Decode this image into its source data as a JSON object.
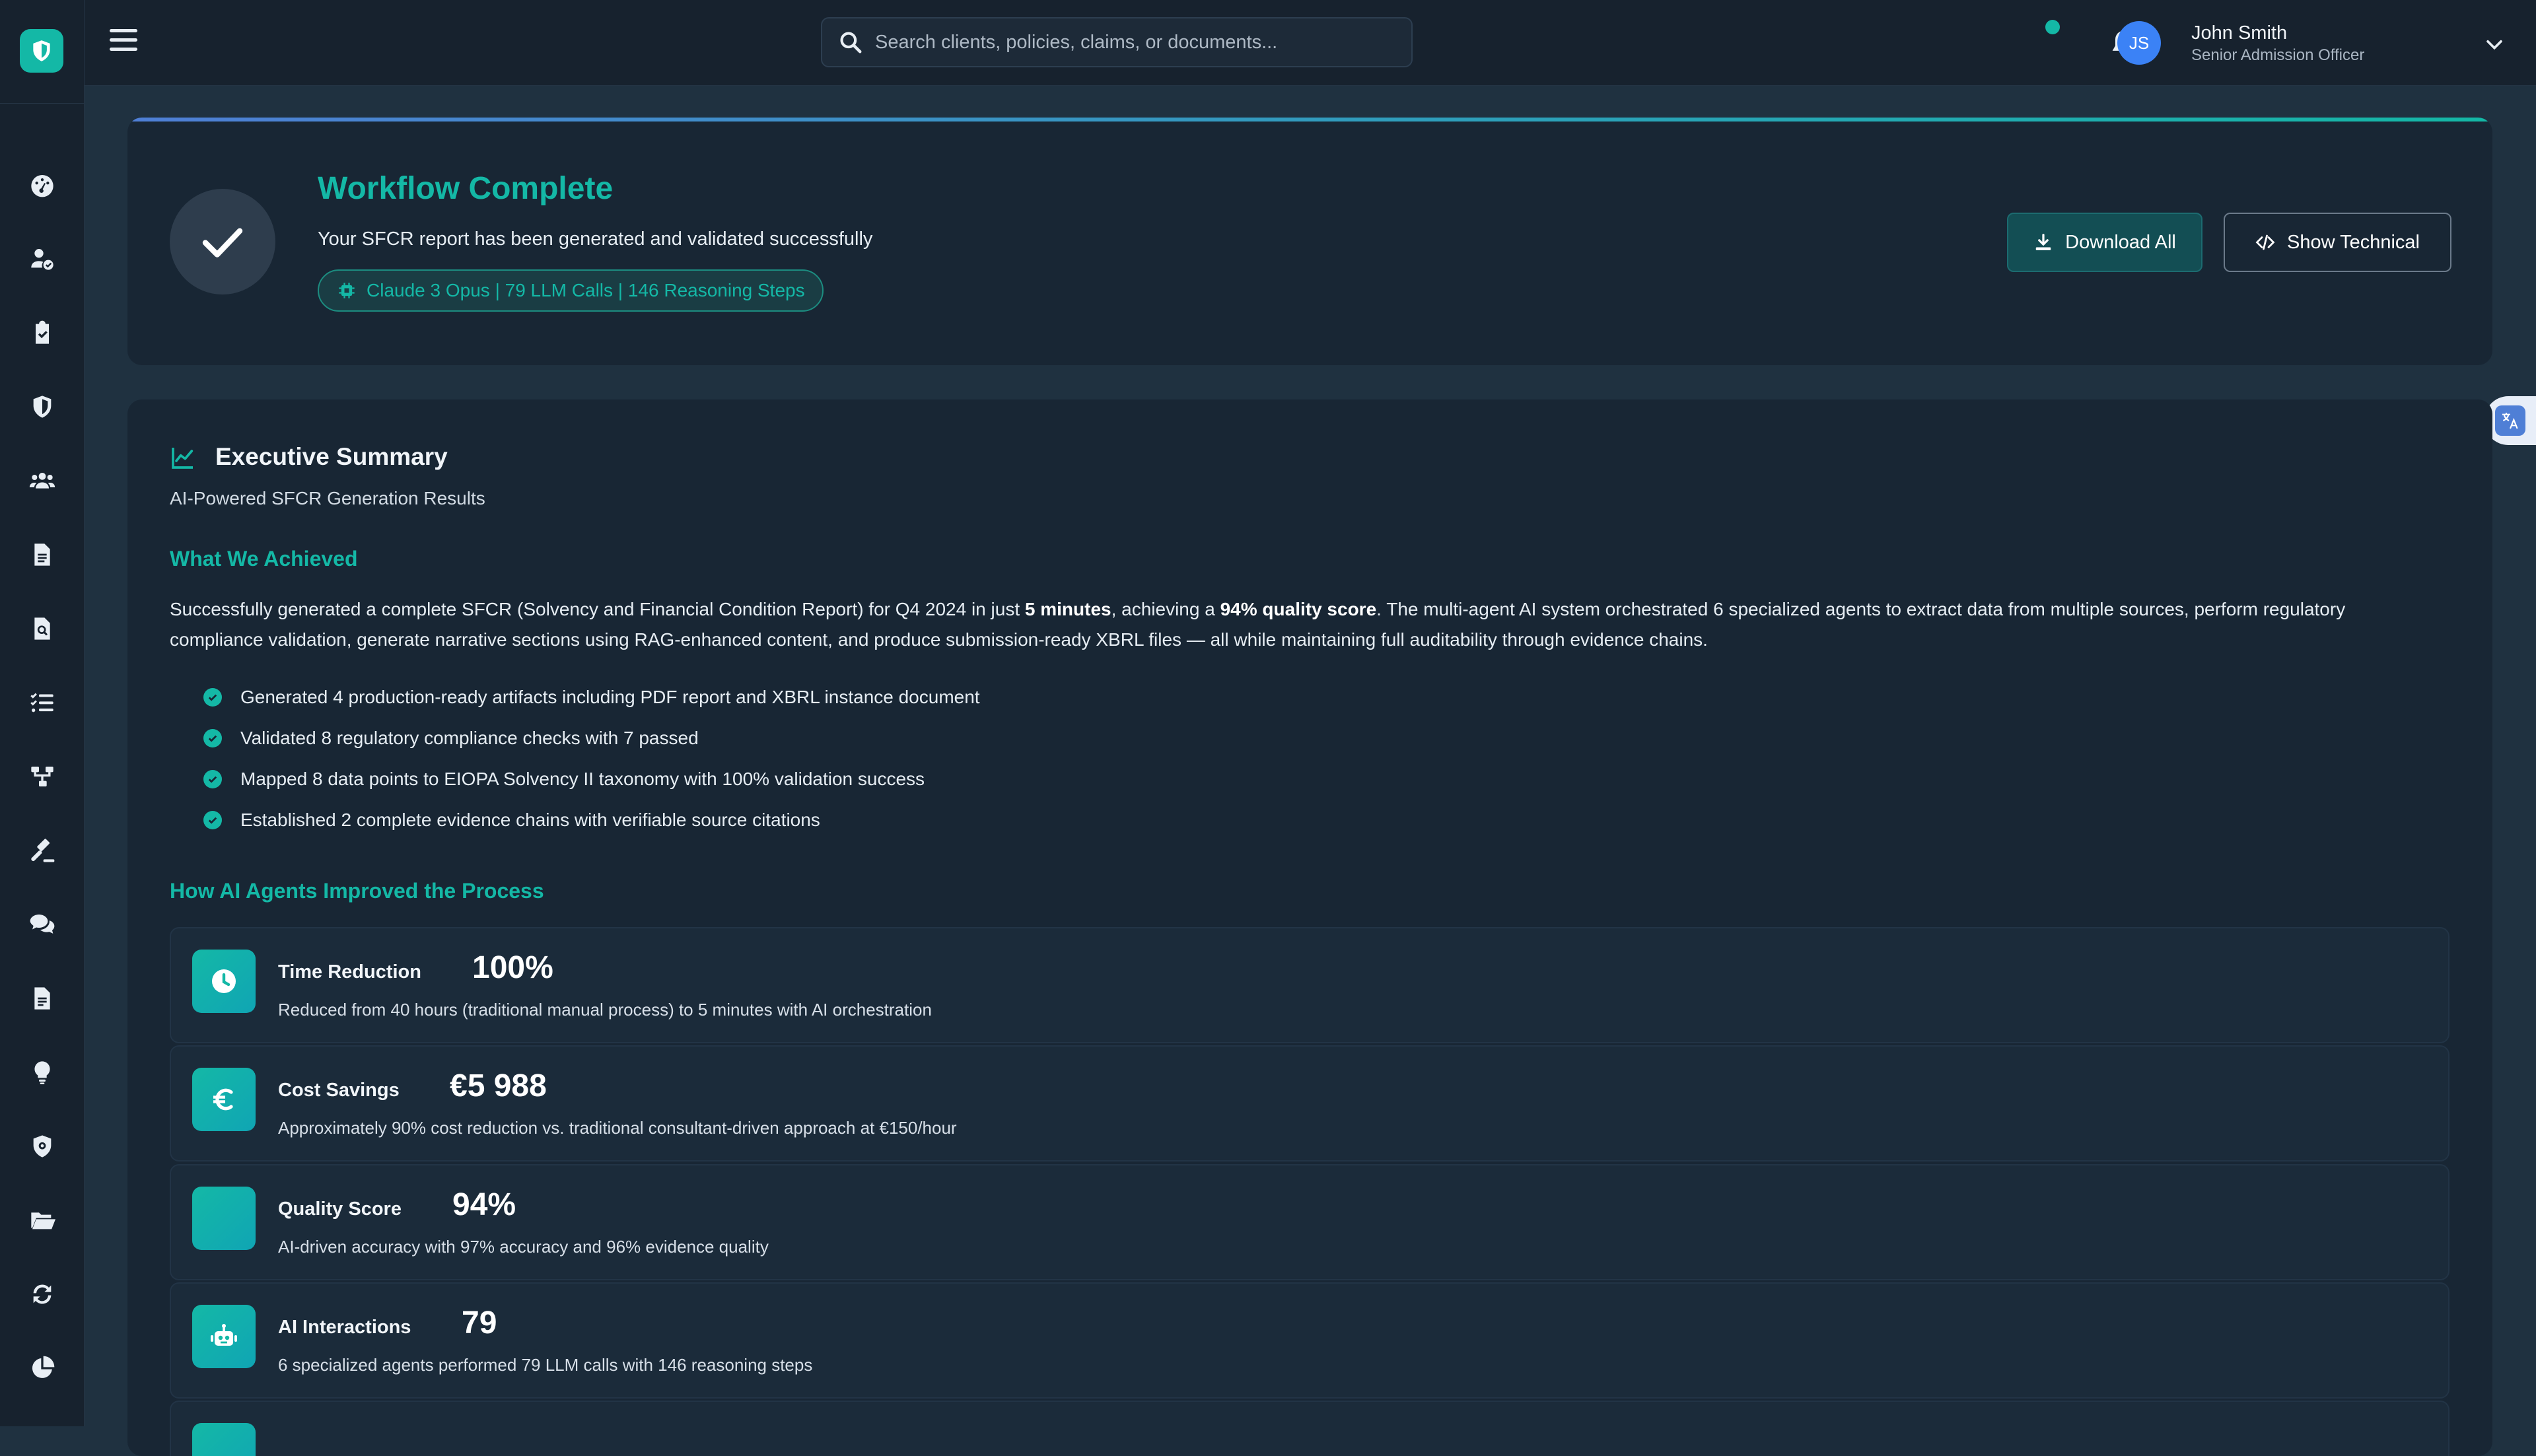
{
  "search": {
    "placeholder": "Search clients, policies, claims, or documents..."
  },
  "user": {
    "initials": "JS",
    "name": "John Smith",
    "role": "Senior Admission Officer"
  },
  "sidebar": {
    "items": [
      {
        "icon": "dashboard-icon"
      },
      {
        "icon": "user-check-icon"
      },
      {
        "icon": "clipboard-check-icon"
      },
      {
        "icon": "shield-icon"
      },
      {
        "icon": "users-icon"
      },
      {
        "icon": "file-icon"
      },
      {
        "icon": "file-search-icon"
      },
      {
        "icon": "list-check-icon"
      },
      {
        "icon": "sitemap-icon"
      },
      {
        "icon": "gavel-icon"
      },
      {
        "icon": "comments-icon"
      },
      {
        "icon": "file-lines-icon"
      },
      {
        "icon": "lightbulb-icon"
      },
      {
        "icon": "shield-gear-icon"
      },
      {
        "icon": "folder-open-icon"
      },
      {
        "icon": "sync-icon"
      },
      {
        "icon": "chart-pie-icon"
      }
    ]
  },
  "workflow": {
    "title": "Workflow Complete",
    "subtitle": "Your SFCR report has been generated and validated successfully",
    "badge": "Claude 3 Opus | 79 LLM Calls | 146 Reasoning Steps",
    "download_label": "Download All",
    "technical_label": "Show Technical"
  },
  "summary": {
    "title": "Executive Summary",
    "subtitle": "AI-Powered SFCR Generation Results",
    "achieved_heading": "What We Achieved",
    "para_1": "Successfully generated a complete SFCR (Solvency and Financial Condition Report) for Q4 2024 in just ",
    "para_b1": "5 minutes",
    "para_2": ", achieving a ",
    "para_b2": "94% quality score",
    "para_3": ". The multi-agent AI system orchestrated 6 specialized agents to extract data from multiple sources, perform regulatory compliance validation, generate narrative sections using RAG-enhanced content, and produce submission-ready XBRL files — all while maintaining full auditability through evidence chains.",
    "bullets": [
      "Generated 4 production-ready artifacts including PDF report and XBRL instance document",
      "Validated 8 regulatory compliance checks with 7 passed",
      "Mapped 8 data points to EIOPA Solvency II taxonomy with 100% validation success",
      "Established 2 complete evidence chains with verifiable source citations"
    ],
    "improved_heading": "How AI Agents Improved the Process",
    "metrics": [
      {
        "label": "Time Reduction",
        "value": "100%",
        "desc": "Reduced from 40 hours (traditional manual process) to 5 minutes with AI orchestration",
        "icon": "clock-icon"
      },
      {
        "label": "Cost Savings",
        "value": "€5 988",
        "desc": "Approximately 90% cost reduction vs. traditional consultant-driven approach at €150/hour",
        "icon": "euro-icon"
      },
      {
        "label": "Quality Score",
        "value": "94%",
        "desc": "AI-driven accuracy with 97% accuracy and 96% evidence quality",
        "icon": "quality-icon"
      },
      {
        "label": "AI Interactions",
        "value": "79",
        "desc": "6 specialized agents performed 79 LLM calls with 146 reasoning steps",
        "icon": "robot-icon"
      }
    ]
  },
  "colors": {
    "accent": "#14b8a6",
    "background": "#1f3140",
    "card": "#182634",
    "avatar": "#3b82f6"
  }
}
